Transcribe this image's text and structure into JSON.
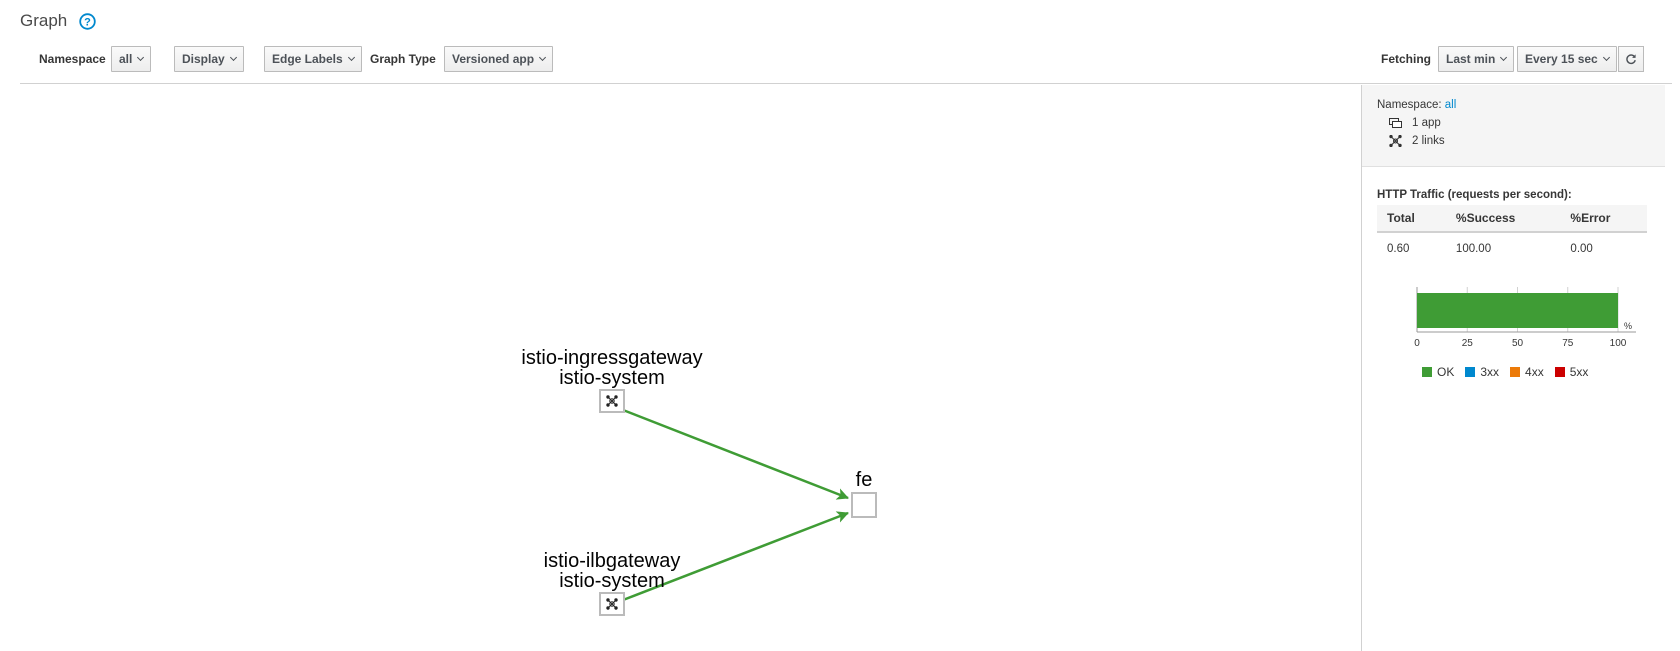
{
  "header": {
    "title": "Graph"
  },
  "toolbar": {
    "namespace_label": "Namespace",
    "namespace_value": "all",
    "display_label": "Display",
    "edge_labels_label": "Edge Labels",
    "graph_type_label": "Graph Type",
    "graph_type_value": "Versioned app",
    "fetching_label": "Fetching",
    "duration_value": "Last min",
    "refresh_value": "Every 15 sec"
  },
  "graph": {
    "nodes": [
      {
        "name": "istio-ingressgateway",
        "namespace": "istio-system"
      },
      {
        "name": "istio-ilbgateway",
        "namespace": "istio-system"
      },
      {
        "name": "fe"
      }
    ],
    "edge_color": "#3f9c35"
  },
  "side": {
    "namespace_label": "Namespace:",
    "namespace_value": "all",
    "apps": "1 app",
    "links": "2 links",
    "traffic_title": "HTTP Traffic (requests per second):",
    "columns": [
      "Total",
      "%Success",
      "%Error"
    ],
    "values": [
      "0.60",
      "100.00",
      "0.00"
    ]
  },
  "chart_data": {
    "type": "bar",
    "orientation": "horizontal",
    "categories": [
      ""
    ],
    "series": [
      {
        "name": "OK",
        "values": [
          100
        ],
        "color": "#3f9c35"
      },
      {
        "name": "3xx",
        "values": [
          0
        ],
        "color": "#0088ce"
      },
      {
        "name": "4xx",
        "values": [
          0
        ],
        "color": "#ec7a08"
      },
      {
        "name": "5xx",
        "values": [
          0
        ],
        "color": "#cc0000"
      }
    ],
    "xticks": [
      "0",
      "25",
      "50",
      "75",
      "100"
    ],
    "xlabel": "%",
    "xlim": [
      0,
      100
    ]
  }
}
